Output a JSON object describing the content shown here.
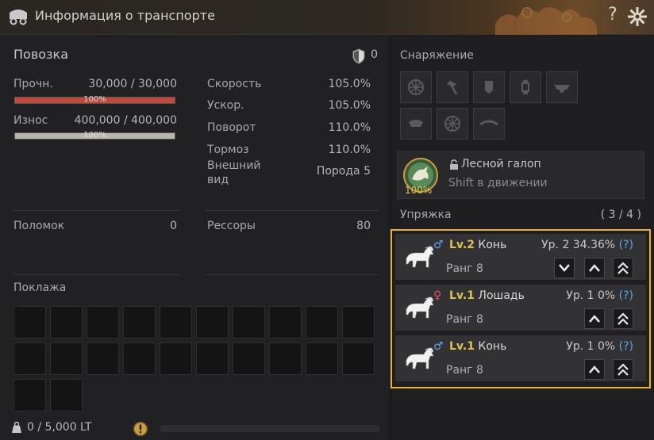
{
  "window": {
    "title": "Информация о транспорте",
    "help": "?"
  },
  "vehicle": {
    "name": "Повозка",
    "defense": "0"
  },
  "stats": {
    "durability": {
      "label": "Прочн.",
      "value": "30,000 / 30,000",
      "pct": "100%",
      "fill": 1.0,
      "color": "#c04a3c"
    },
    "wear": {
      "label": "Износ",
      "value": "400,000 / 400,000",
      "pct": "100%",
      "fill": 1.0,
      "color": "#b9b6ae"
    },
    "speed": {
      "label": "Скорость",
      "value": "105.0%"
    },
    "accel": {
      "label": "Ускор.",
      "value": "105.0%"
    },
    "turn": {
      "label": "Поворот",
      "value": "110.0%"
    },
    "brake": {
      "label": "Тормоз",
      "value": "110.0%"
    },
    "appearance": {
      "label_line1": "Внешний",
      "label_line2": "вид",
      "value": "Порода 5"
    },
    "breakdowns": {
      "label": "Поломок",
      "value": "0"
    },
    "springs": {
      "label": "Рессоры",
      "value": "80"
    }
  },
  "cargo": {
    "title": "Поклажа",
    "weight": "0 / 5,000 LT",
    "weight_fill": 0.0
  },
  "equipment": {
    "title": "Снаряжение"
  },
  "skill": {
    "name": "Лесной галоп",
    "key": "Shift в движении",
    "pct": "100%"
  },
  "harness": {
    "title": "Упряжка",
    "count": "( 3 / 4 )",
    "horses": [
      {
        "lv": "Lv.2",
        "name": "Конь",
        "gender": "♂",
        "gender_color": "#5aa8e8",
        "rank": "Ранг 8",
        "xp": "Ур. 2 34.36% ",
        "q": "(?)"
      },
      {
        "lv": "Lv.1",
        "name": "Лошадь",
        "gender": "♀",
        "gender_color": "#e0506a",
        "rank": "Ранг 8",
        "xp": "Ур. 1 0% ",
        "q": "(?)"
      },
      {
        "lv": "Lv.1",
        "name": "Конь",
        "gender": "♂",
        "gender_color": "#5aa8e8",
        "rank": "Ранг 8",
        "xp": "Ур. 1 0% ",
        "q": "(?)"
      }
    ]
  }
}
